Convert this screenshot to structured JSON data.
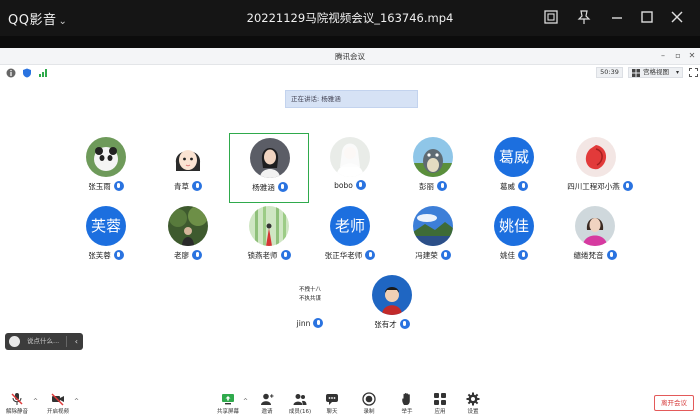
{
  "player": {
    "brand": "QQ影音",
    "file_title": "20221129马院视频会议_163746.mp4"
  },
  "app": {
    "title": "腾讯会议",
    "timer": "50:39",
    "view_mode": "宫格视图",
    "speaking_label": "正在讲话: 杨雅涵"
  },
  "participants": [
    {
      "name": "张玉雨",
      "avatar": "photo-panda",
      "mic": true
    },
    {
      "name": "青草",
      "avatar": "photo-cartoon-girl",
      "mic": true
    },
    {
      "name": "杨雅涵",
      "avatar": "photo-woman",
      "mic": true,
      "active": true
    },
    {
      "name": "bobo",
      "avatar": "photo-bride",
      "mic": true
    },
    {
      "name": "彭丽",
      "avatar": "photo-totoro",
      "mic": true
    },
    {
      "name": "葛威",
      "avatar_text": "葛威",
      "mic": true
    },
    {
      "name": "四川工程邓小燕",
      "avatar": "photo-flower",
      "mic": true
    },
    {
      "name": "张芙蓉",
      "avatar_text": "芙蓉",
      "mic": true
    },
    {
      "name": "老廖",
      "avatar": "photo-forest",
      "mic": true
    },
    {
      "name": "锁燕老师",
      "avatar": "photo-bamboo",
      "mic": true
    },
    {
      "name": "张正华老师",
      "avatar_text": "老师",
      "mic": true
    },
    {
      "name": "冯建荣",
      "avatar": "photo-lake",
      "mic": true
    },
    {
      "name": "姚佳",
      "avatar_text": "姚佳",
      "mic": true
    },
    {
      "name": "缱绻梵音",
      "avatar": "photo-woman-pink",
      "mic": true
    },
    {
      "name": "jinn",
      "avatar": "photo-calligraphy",
      "mic": true
    },
    {
      "name": "张有才",
      "avatar": "photo-boy",
      "mic": true
    }
  ],
  "calligraphy_lines": [
    "不拽十八",
    "不执共谋"
  ],
  "chat": {
    "placeholder": "说点什么..."
  },
  "bottom_bar": {
    "unmute": "解除静音",
    "video": "开启视频",
    "share": "共享屏幕",
    "invite": "邀请",
    "members": "成员(16)",
    "chat": "聊天",
    "record": "录制",
    "raise_hand": "举手",
    "apps": "应用",
    "settings": "设置",
    "leave": "离开会议"
  },
  "colors": {
    "accent": "#1c6fdf",
    "active_border": "#2faa4c",
    "leave": "#d63b3b"
  }
}
